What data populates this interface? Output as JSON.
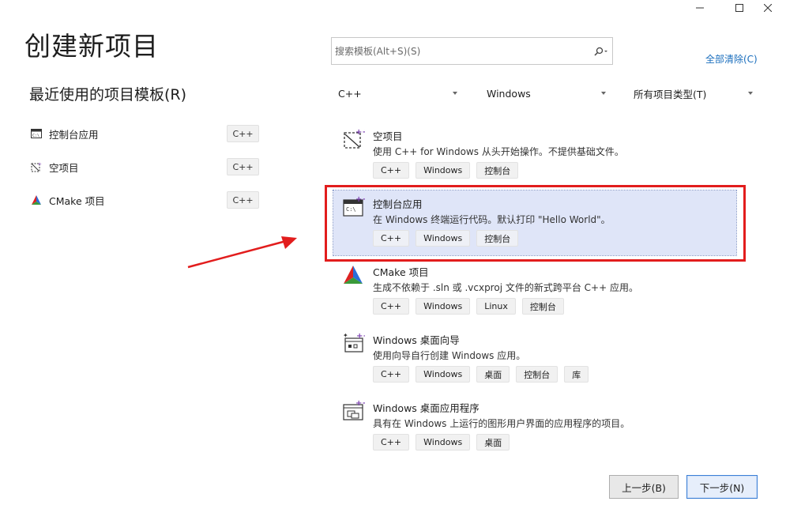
{
  "window": {
    "minimize": "—",
    "maximize": "☐",
    "close": "✕"
  },
  "page_title": "创建新项目",
  "recent": {
    "title": "最近使用的项目模板(R)",
    "items": [
      {
        "label": "控制台应用",
        "tag": "C++",
        "icon": "console-icon"
      },
      {
        "label": "空项目",
        "tag": "C++",
        "icon": "empty-project-icon"
      },
      {
        "label": "CMake 项目",
        "tag": "C++",
        "icon": "cmake-icon"
      }
    ]
  },
  "search": {
    "placeholder": "搜索模板(Alt+S)(S)",
    "clear_all": "全部清除(C)"
  },
  "filters": {
    "language": "C++",
    "platform": "Windows",
    "project_type": "所有项目类型(T)"
  },
  "templates": [
    {
      "title": "空项目",
      "desc": "使用 C++ for Windows 从头开始操作。不提供基础文件。",
      "tags": [
        "C++",
        "Windows",
        "控制台"
      ],
      "icon": "empty-project-icon"
    },
    {
      "title": "控制台应用",
      "desc": "在 Windows 终端运行代码。默认打印 \"Hello World\"。",
      "tags": [
        "C++",
        "Windows",
        "控制台"
      ],
      "icon": "console-icon",
      "selected": true
    },
    {
      "title": "CMake 项目",
      "desc": "生成不依赖于 .sln 或 .vcxproj 文件的新式跨平台 C++ 应用。",
      "tags": [
        "C++",
        "Windows",
        "Linux",
        "控制台"
      ],
      "icon": "cmake-icon"
    },
    {
      "title": "Windows 桌面向导",
      "desc": "使用向导自行创建 Windows 应用。",
      "tags": [
        "C++",
        "Windows",
        "桌面",
        "控制台",
        "库"
      ],
      "icon": "wizard-icon"
    },
    {
      "title": "Windows 桌面应用程序",
      "desc": "具有在 Windows 上运行的图形用户界面的应用程序的项目。",
      "tags": [
        "C++",
        "Windows",
        "桌面"
      ],
      "icon": "desktop-app-icon"
    }
  ],
  "buttons": {
    "back": "上一步(B)",
    "next": "下一步(N)"
  },
  "colors": {
    "highlight": "#e21d1d",
    "selected_bg": "#dfe5f8",
    "link": "#1a6ebd"
  }
}
